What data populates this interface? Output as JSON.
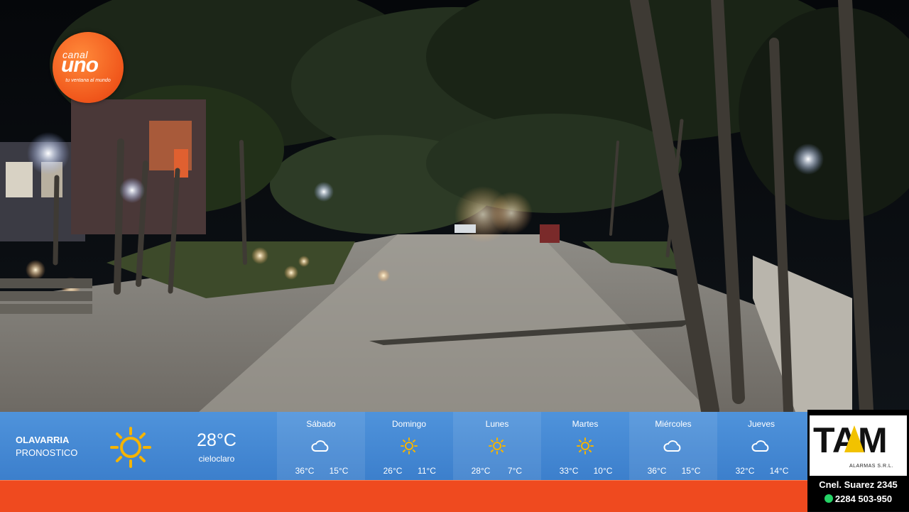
{
  "logo": {
    "line1": "canal",
    "line2": "uno",
    "tagline": "tu ventana al mundo"
  },
  "weather": {
    "city": "OLAVARRIA",
    "subtitle": "PRONOSTICO",
    "current": {
      "temp": "28°C",
      "condition": "cieloclaro",
      "icon": "sun-icon"
    },
    "forecast": [
      {
        "day": "Sábado",
        "icon": "cloud-icon",
        "max": "36°C",
        "min": "15°C"
      },
      {
        "day": "Domingo",
        "icon": "sun-icon",
        "max": "26°C",
        "min": "11°C"
      },
      {
        "day": "Lunes",
        "icon": "sun-icon",
        "max": "28°C",
        "min": "7°C"
      },
      {
        "day": "Martes",
        "icon": "sun-icon",
        "max": "33°C",
        "min": "10°C"
      },
      {
        "day": "Miércoles",
        "icon": "cloud-icon",
        "max": "36°C",
        "min": "15°C"
      },
      {
        "day": "Jueves",
        "icon": "cloud-icon",
        "max": "32°C",
        "min": "14°C"
      }
    ]
  },
  "sponsor": {
    "brand": "TAM",
    "tagline": "ALARMAS S.R.L.",
    "address": "Cnel. Suarez 2345",
    "phone": "2284 503-950"
  },
  "colors": {
    "bar": "#4a8fd8",
    "ticker": "#ef4a1f",
    "sun": "#f5b400"
  }
}
